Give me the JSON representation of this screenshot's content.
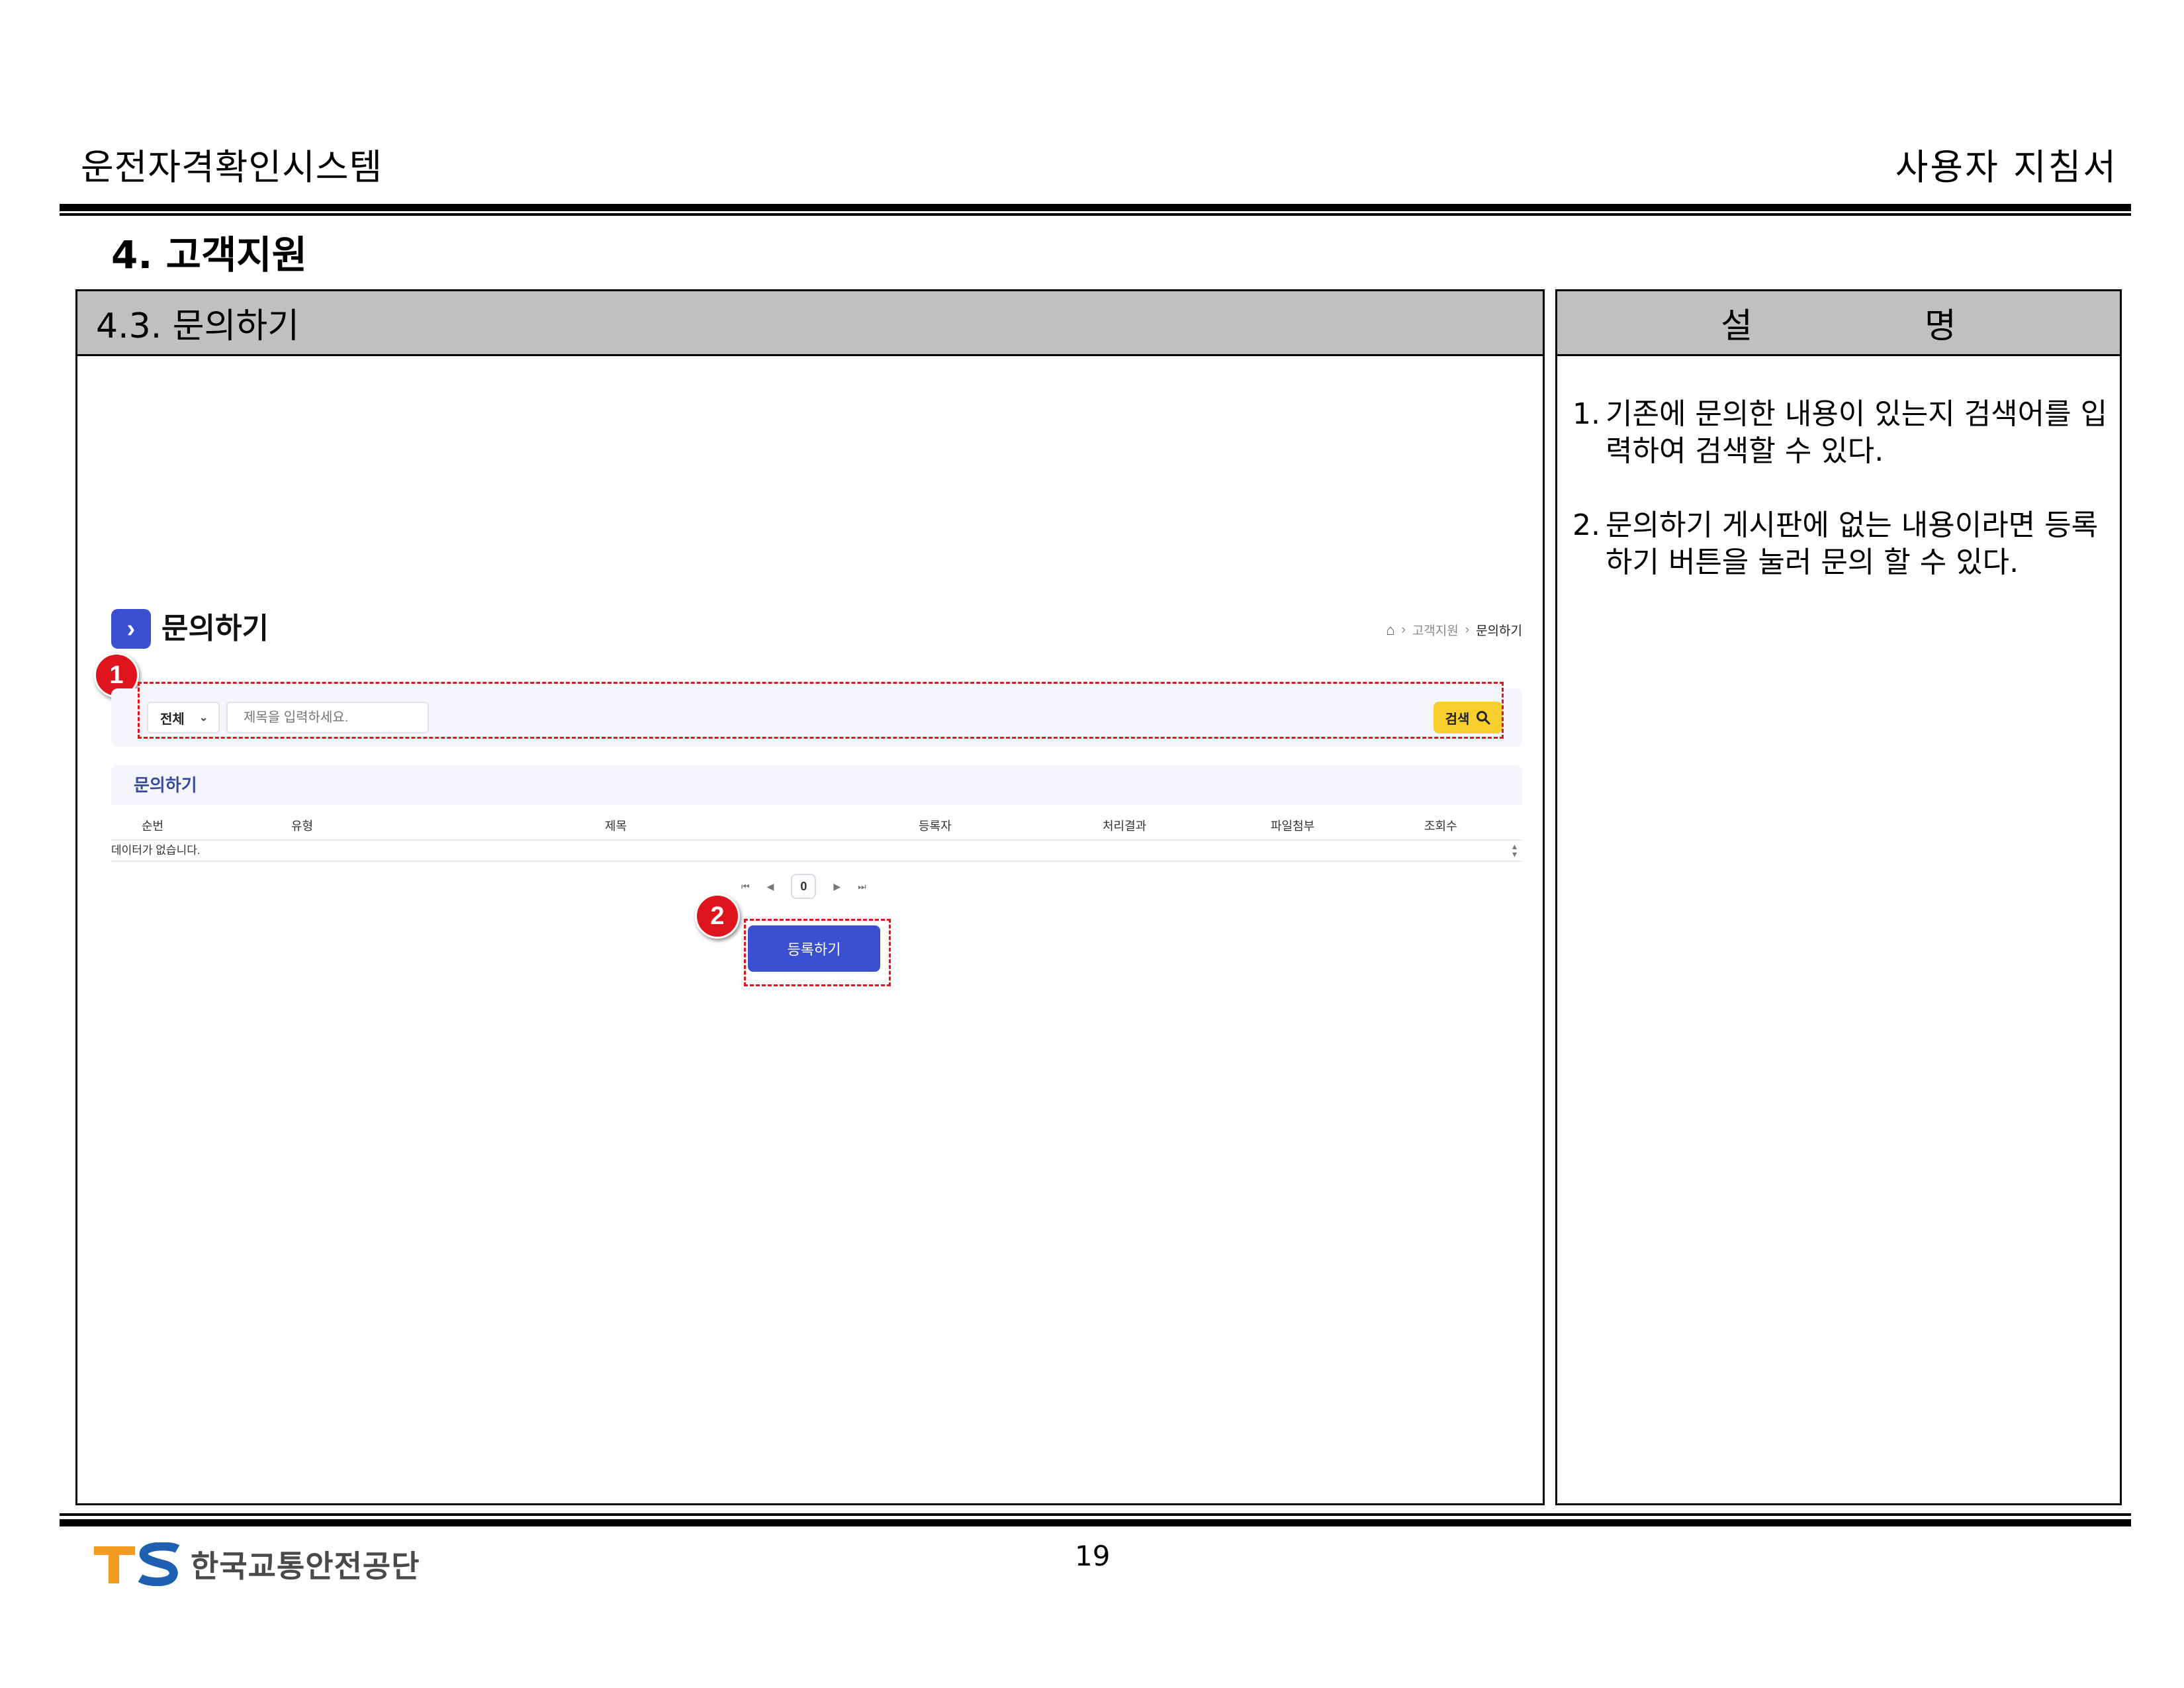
{
  "header": {
    "system_name": "운전자격확인시스템",
    "doc_type": "사용자 지침서"
  },
  "section": {
    "heading": "4. 고객지원",
    "subsection": "4.3. 문의하기"
  },
  "description": {
    "header_chars": [
      "설",
      "명"
    ],
    "items": [
      {
        "num": "1.",
        "text": "기존에 문의한 내용이 있는지 검색어를 입력하여 검색할 수 있다."
      },
      {
        "num": "2.",
        "text": "문의하기 게시판에 없는 내용이라면 등록하기 버튼을 눌러 문의 할 수 있다."
      }
    ]
  },
  "screenshot": {
    "page_title": "문의하기",
    "breadcrumb": [
      "고객지원",
      "문의하기"
    ],
    "search": {
      "category": "전체",
      "placeholder": "제목을 입력하세요.",
      "button_label": "검색"
    },
    "board": {
      "title": "문의하기",
      "columns": [
        "순번",
        "유형",
        "제목",
        "등록자",
        "처리결과",
        "파일첨부",
        "조회수"
      ],
      "empty_message": "데이터가 없습니다."
    },
    "pager": {
      "current_page": "0"
    },
    "register_button": "등록하기",
    "markers": [
      "1",
      "2"
    ]
  },
  "footer": {
    "page_number": "19",
    "org_name": "한국교통안전공단",
    "logo_letters": "TS"
  },
  "colors": {
    "accent_blue": "#3b4fd1",
    "search_yellow": "#f8cf2c",
    "marker_red": "#e0141c",
    "header_gray": "#c0c0c0",
    "logo_orange": "#f29a1f"
  }
}
